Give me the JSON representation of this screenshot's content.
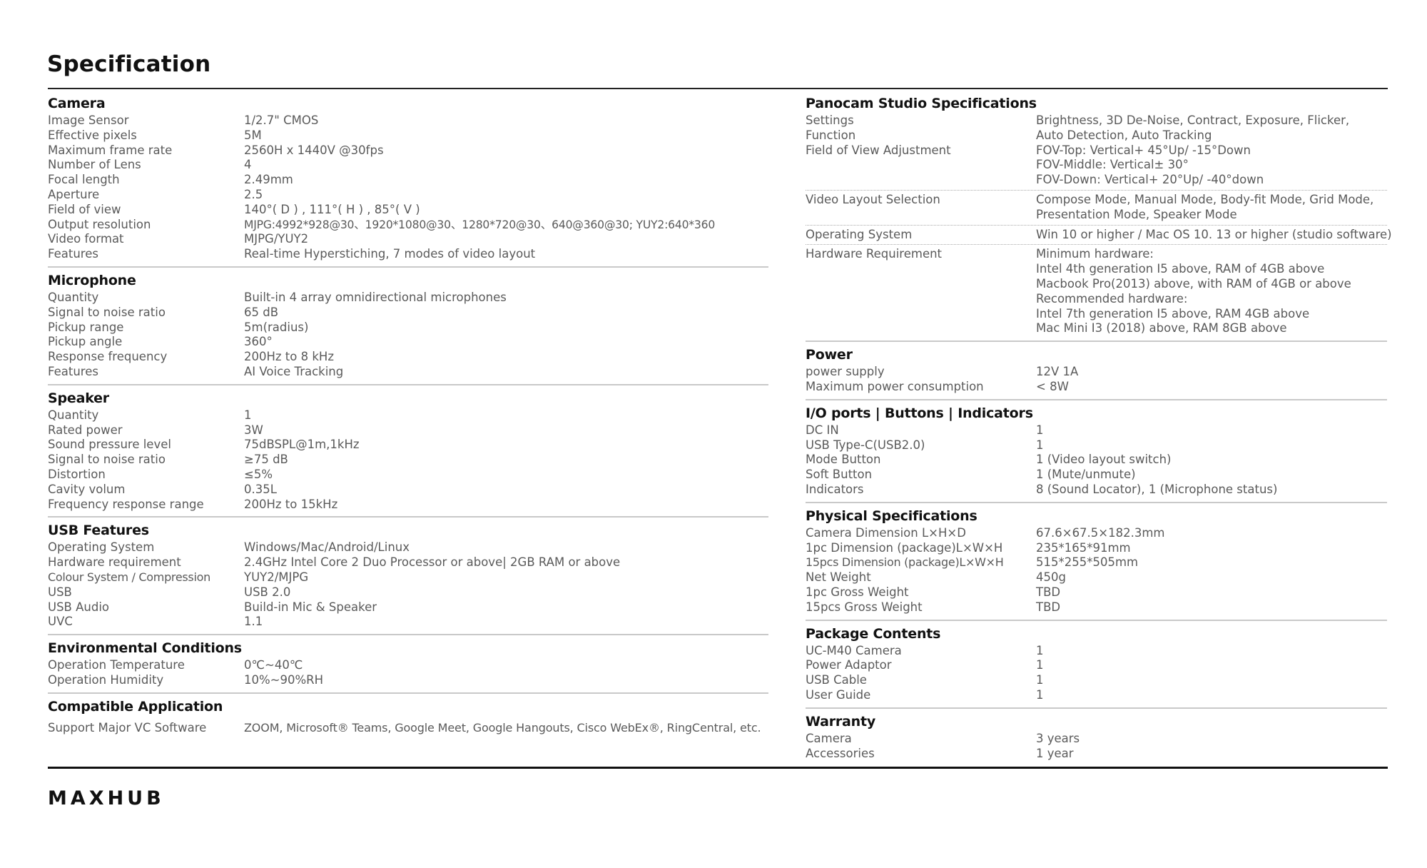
{
  "title": "Specification",
  "brand": "MAXHUB",
  "left": {
    "camera": {
      "title": "Camera",
      "rows": [
        {
          "label": "Image Sensor",
          "value": "1/2.7\" CMOS"
        },
        {
          "label": "Effective pixels",
          "value": "5M"
        },
        {
          "label": "Maximum frame rate",
          "value": "2560H x 1440V @30fps"
        },
        {
          "label": "Number of Lens",
          "value": "4"
        },
        {
          "label": "Focal length",
          "value": "2.49mm"
        },
        {
          "label": "Aperture",
          "value": "2.5"
        },
        {
          "label": "Field of view",
          "value": "140°( D ) , 111°( H ) , 85°( V )"
        },
        {
          "label": "Output resolution",
          "value": "MJPG:4992*928@30、1920*1080@30、1280*720@30、640@360@30; YUY2:640*360"
        },
        {
          "label": "Video format",
          "value": "MJPG/YUY2"
        },
        {
          "label": "Features",
          "value": "Real-time Hyperstiching, 7 modes of video layout"
        }
      ]
    },
    "microphone": {
      "title": "Microphone",
      "rows": [
        {
          "label": "Quantity",
          "value": "Built-in 4 array omnidirectional microphones"
        },
        {
          "label": "Signal to noise ratio",
          "value": "65 dB"
        },
        {
          "label": "Pickup range",
          "value": "5m(radius)"
        },
        {
          "label": "Pickup angle",
          "value": "360°"
        },
        {
          "label": "Response frequency",
          "value": "200Hz to 8 kHz"
        },
        {
          "label": "Features",
          "value": "AI Voice Tracking"
        }
      ]
    },
    "speaker": {
      "title": "Speaker",
      "rows": [
        {
          "label": "Quantity",
          "value": "1"
        },
        {
          "label": "Rated power",
          "value": "3W"
        },
        {
          "label": "Sound pressure level",
          "value": "75dBSPL@1m,1kHz"
        },
        {
          "label": "Signal to noise ratio",
          "value": "≥75 dB"
        },
        {
          "label": "Distortion",
          "value": "≤5%"
        },
        {
          "label": "Cavity volum",
          "value": "0.35L"
        },
        {
          "label": "Frequency response range",
          "value": "200Hz to 15kHz"
        }
      ]
    },
    "usb": {
      "title": "USB Features",
      "rows": [
        {
          "label": "Operating System",
          "value": "Windows/Mac/Android/Linux"
        },
        {
          "label": "Hardware requirement",
          "value": "2.4GHz Intel Core 2 Duo Processor or above| 2GB RAM or above"
        },
        {
          "label": "Colour System / Compression",
          "value": "YUY2/MJPG"
        },
        {
          "label": "USB",
          "value": "USB 2.0"
        },
        {
          "label": "USB Audio",
          "value": "Build-in Mic & Speaker"
        },
        {
          "label": "UVC",
          "value": "1.1"
        }
      ]
    },
    "environment": {
      "title": "Environmental Conditions",
      "rows": [
        {
          "label": "Operation Temperature",
          "value": "0℃~40℃"
        },
        {
          "label": "Operation Humidity",
          "value": "10%~90%RH"
        }
      ]
    },
    "compatible": {
      "title": "Compatible Application",
      "rows": [
        {
          "label": "Support Major VC Software",
          "value": "ZOOM, Microsoft® Teams, Google Meet, Google Hangouts, Cisco WebEx®, RingCentral, etc."
        }
      ]
    }
  },
  "right": {
    "panocam": {
      "title": "Panocam Studio Specifications",
      "rows": [
        {
          "label": "Settings",
          "lines": [
            "Brightness, 3D De-Noise, Contract, Exposure, Flicker,"
          ]
        },
        {
          "label": "Function",
          "lines": [
            "Auto Detection, Auto Tracking"
          ]
        },
        {
          "label": "Field of View Adjustment",
          "lines": [
            "FOV-Top: Vertical+ 45°Up/ -15°Down",
            "FOV-Middle: Vertical± 30°",
            "FOV-Down: Vertical+ 20°Up/ -40°down"
          ]
        },
        {
          "label": "Video Layout Selection",
          "lines": [
            "Compose Mode, Manual Mode, Body-fit Mode, Grid Mode,",
            "Presentation Mode, Speaker Mode"
          ]
        },
        {
          "label": "Operating System",
          "lines": [
            "Win 10 or higher / Mac OS 10. 13 or higher (studio software)"
          ]
        },
        {
          "label": "Hardware Requirement",
          "lines": [
            "Minimum hardware:",
            "Intel 4th generation I5 above, RAM of 4GB above",
            "Macbook Pro(2013) above, with RAM of 4GB or above",
            "Recommended hardware:",
            "Intel 7th generation I5 above, RAM 4GB above",
            "Mac Mini I3 (2018) above, RAM 8GB above"
          ]
        }
      ]
    },
    "power": {
      "title": "Power",
      "rows": [
        {
          "label": "power supply",
          "value": "12V 1A"
        },
        {
          "label": "Maximum power consumption",
          "value": "< 8W"
        }
      ]
    },
    "io": {
      "title": "I/O ports | Buttons | Indicators",
      "rows": [
        {
          "label": "DC IN",
          "value": "1"
        },
        {
          "label": "USB Type-C(USB2.0)",
          "value": "1"
        },
        {
          "label": "Mode Button",
          "value": "1 (Video layout switch)"
        },
        {
          "label": "Soft Button",
          "value": "1 (Mute/unmute)"
        },
        {
          "label": "Indicators",
          "value": "8 (Sound Locator), 1 (Microphone status)"
        }
      ]
    },
    "physical": {
      "title": "Physical Specifications",
      "rows": [
        {
          "label": "Camera Dimension L×H×D",
          "value": "67.6×67.5×182.3mm"
        },
        {
          "label": "1pc Dimension (package)L×W×H",
          "value": "235*165*91mm"
        },
        {
          "label": "15pcs Dimension (package)L×W×H",
          "value": "515*255*505mm"
        },
        {
          "label": "Net Weight",
          "value": "450g"
        },
        {
          "label": "1pc Gross Weight",
          "value": "TBD"
        },
        {
          "label": "15pcs Gross Weight",
          "value": "TBD"
        }
      ]
    },
    "package": {
      "title": "Package Contents",
      "rows": [
        {
          "label": "UC-M40 Camera",
          "value": "1"
        },
        {
          "label": "Power Adaptor",
          "value": "1"
        },
        {
          "label": "USB Cable",
          "value": "1"
        },
        {
          "label": "User Guide",
          "value": "1"
        }
      ]
    },
    "warranty": {
      "title": "Warranty",
      "rows": [
        {
          "label": "Camera",
          "value": "3 years"
        },
        {
          "label": "Accessories",
          "value": "1 year"
        }
      ]
    }
  }
}
